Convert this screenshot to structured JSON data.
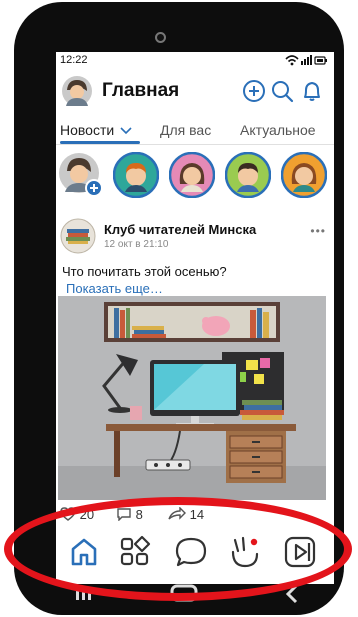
{
  "status_bar": {
    "time": "12:22"
  },
  "header": {
    "title": "Главная"
  },
  "tabs": [
    {
      "label": "Новости",
      "active": true
    },
    {
      "label": "Для вас",
      "active": false
    },
    {
      "label": "Актуальное",
      "active": false
    }
  ],
  "post": {
    "author": "Клуб читателей Минска",
    "date": "12 окт в 21:10",
    "text": "Что почитать этой осенью?",
    "show_more": "Показать еще…",
    "reactions": {
      "likes": "20",
      "comments": "8",
      "shares": "14"
    }
  },
  "colors": {
    "accent": "#2a6fb8",
    "highlight": "#e3141b"
  },
  "icons": {
    "header": [
      "add-circle-icon",
      "search-icon",
      "bell-icon"
    ],
    "nav": [
      "home-icon",
      "services-icon",
      "messages-icon",
      "clips-icon",
      "video-icon"
    ]
  }
}
